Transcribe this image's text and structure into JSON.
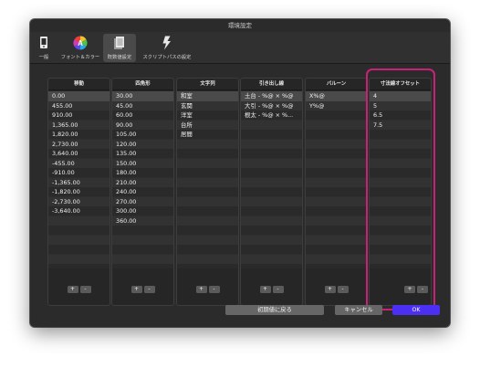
{
  "window": {
    "title": "環境設定"
  },
  "toolbar": {
    "items": [
      {
        "label": "一般",
        "icon": "general-device-icon"
      },
      {
        "label": "フォント＆カラー",
        "icon": "color-wheel-icon"
      },
      {
        "label": "既数値設定",
        "icon": "document-stack-icon"
      },
      {
        "label": "スクリプトパスの設定",
        "icon": "script-lightning-icon"
      }
    ],
    "selected_index": 2
  },
  "columns": [
    {
      "header": "移動",
      "rows": [
        "0.00",
        "455.00",
        "910.00",
        "1,365.00",
        "1,820.00",
        "2,730.00",
        "3,640.00",
        "-455.00",
        "-910.00",
        "-1,365.00",
        "-1,820.00",
        "-2,730.00",
        "-3,640.00"
      ]
    },
    {
      "header": "四角形",
      "rows": [
        "30.00",
        "45.00",
        "60.00",
        "90.00",
        "105.00",
        "120.00",
        "135.00",
        "150.00",
        "180.00",
        "210.00",
        "240.00",
        "270.00",
        "300.00",
        "360.00"
      ]
    },
    {
      "header": "文字列",
      "rows": [
        "和室",
        "玄関",
        "洋室",
        "台所",
        "居間"
      ]
    },
    {
      "header": "引き出し線",
      "rows": [
        "土台 - %@ × %@",
        "大引 - %@ × %@",
        "根太 - %@ × %..."
      ]
    },
    {
      "header": "バルーン",
      "rows": [
        "X%@",
        "Y%@"
      ]
    },
    {
      "header": "寸法線オフセット",
      "rows": [
        "4",
        "5",
        "6.5",
        "7.5"
      ]
    }
  ],
  "list_buttons": {
    "add": "+",
    "remove": "-"
  },
  "footer": {
    "reset_label": "初期値に戻る",
    "cancel_label": "キャンセル",
    "ok_label": "OK"
  },
  "colors": {
    "accent": "#4b2ff2",
    "highlight": "#c8217a"
  }
}
